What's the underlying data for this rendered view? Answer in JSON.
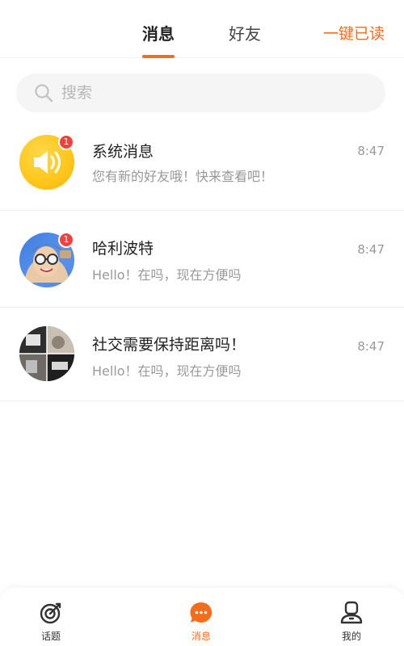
{
  "header": {
    "tabs": [
      {
        "label": "消息",
        "active": true
      },
      {
        "label": "好友",
        "active": false
      }
    ],
    "mark_all_read": "一键已读"
  },
  "search": {
    "placeholder": "搜索"
  },
  "conversations": [
    {
      "name": "系统消息",
      "preview": "您有新的好友哦！快来查看吧！",
      "time": "8:47",
      "unread": "1",
      "avatar": "speaker-icon"
    },
    {
      "name": "哈利波特",
      "preview": "Hello！在吗，现在方便吗",
      "time": "8:47",
      "unread": "1",
      "avatar": "user-photo"
    },
    {
      "name": "社交需要保持距离吗！",
      "preview": "Hello！在吗，现在方便吗",
      "time": "8:47",
      "unread": "",
      "avatar": "group-photo"
    }
  ],
  "bottom_nav": [
    {
      "label": "话题",
      "icon": "target-icon",
      "active": false
    },
    {
      "label": "消息",
      "icon": "chat-bubble-icon",
      "active": true
    },
    {
      "label": "我的",
      "icon": "profile-icon",
      "active": false
    }
  ],
  "colors": {
    "accent": "#f56c1a",
    "badge": "#f0413f"
  }
}
